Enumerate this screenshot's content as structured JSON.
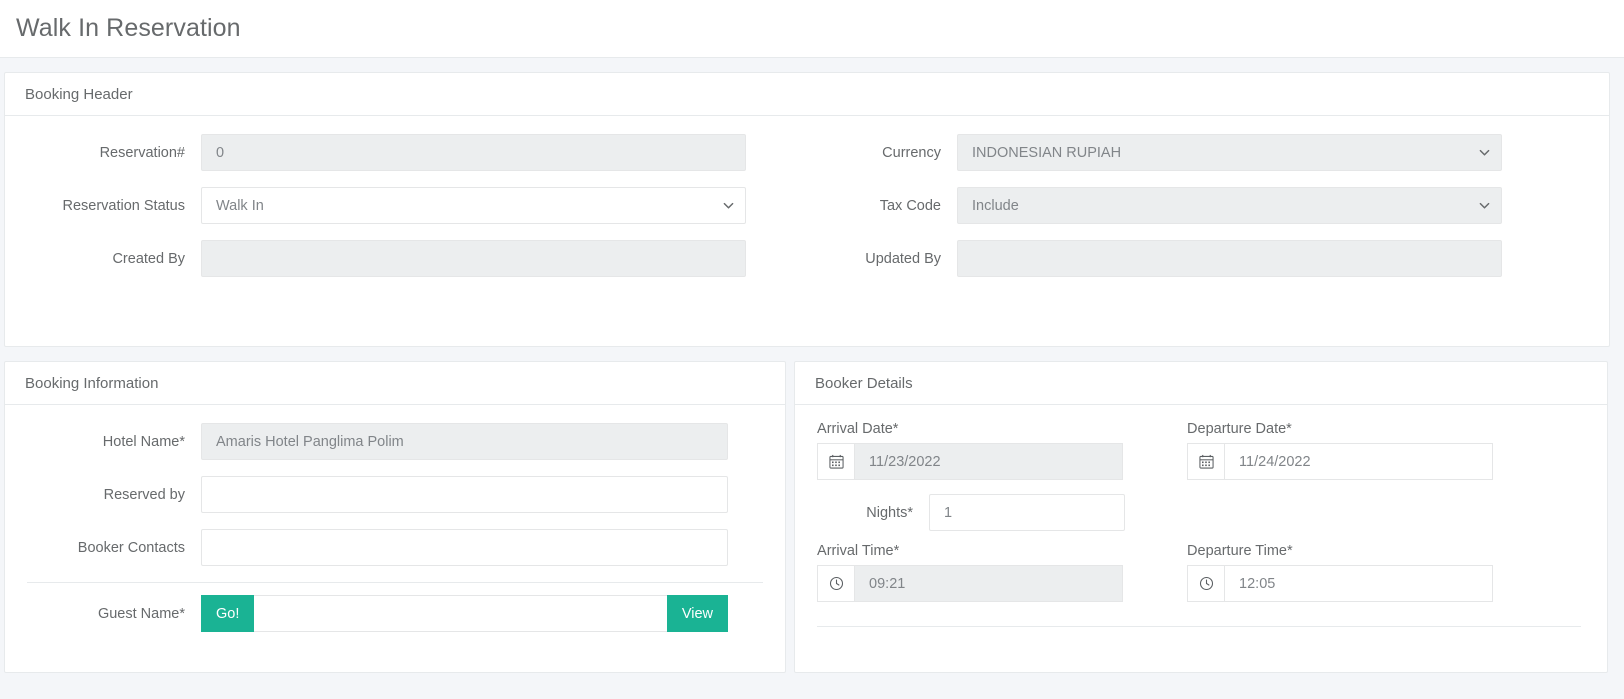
{
  "page": {
    "title": "Walk In Reservation"
  },
  "colors": {
    "accent_green": "#1ab394",
    "text": "#676a6c",
    "page_background": "#f4f6f9",
    "disabled_field": "#eceeef",
    "border": "#e7eaec"
  },
  "booking_header": {
    "title": "Booking Header",
    "left_fields": [
      {
        "label": "Reservation#",
        "value": "0",
        "type": "text",
        "disabled": true
      },
      {
        "label": "Reservation Status",
        "value": "Walk In",
        "type": "select",
        "disabled": false
      },
      {
        "label": "Created By",
        "value": "",
        "type": "text",
        "disabled": true
      }
    ],
    "right_fields": [
      {
        "label": "Currency",
        "value": "INDONESIAN RUPIAH",
        "type": "select",
        "disabled": true
      },
      {
        "label": "Tax Code",
        "value": "Include",
        "type": "select",
        "disabled": true
      },
      {
        "label": "Updated By",
        "value": "",
        "type": "text",
        "disabled": true
      }
    ]
  },
  "booking_information": {
    "title": "Booking Information",
    "fields": [
      {
        "label": "Hotel Name*",
        "value": "Amaris Hotel Panglima Polim",
        "disabled": true
      },
      {
        "label": "Reserved by",
        "value": "",
        "disabled": false
      },
      {
        "label": "Booker Contacts",
        "value": "",
        "disabled": false
      }
    ],
    "guest": {
      "label": "Guest Name*",
      "value": "",
      "go_button": "Go!",
      "view_button": "View"
    }
  },
  "booker_details": {
    "title": "Booker Details",
    "arrival_date": {
      "label": "Arrival Date*",
      "value": "11/23/2022",
      "icon": "calendar-icon",
      "disabled": true
    },
    "departure_date": {
      "label": "Departure Date*",
      "value": "11/24/2022",
      "icon": "calendar-icon",
      "disabled": false
    },
    "nights": {
      "label": "Nights*",
      "value": "1",
      "disabled": false
    },
    "arrival_time": {
      "label": "Arrival Time*",
      "value": "09:21",
      "icon": "clock-icon",
      "disabled": true
    },
    "departure_time": {
      "label": "Departure Time*",
      "value": "12:05",
      "icon": "clock-icon",
      "disabled": false
    }
  }
}
